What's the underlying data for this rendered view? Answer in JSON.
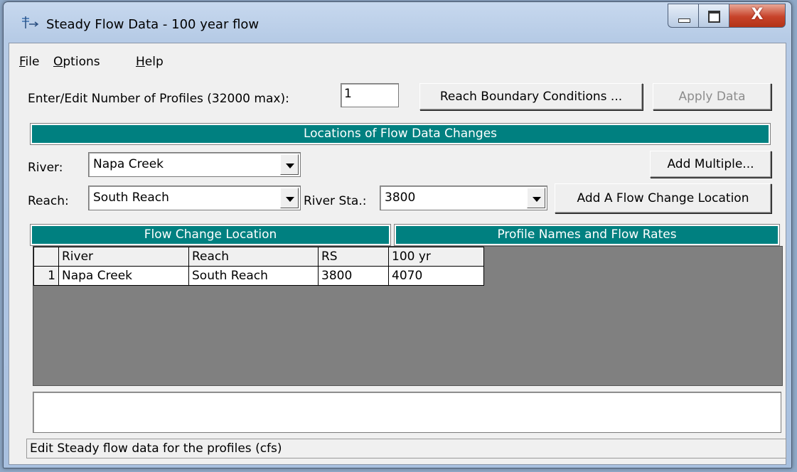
{
  "window": {
    "title": "Steady Flow Data - 100 year flow",
    "icon": "steady-flow-icon",
    "close_glyph": "X"
  },
  "menu": [
    {
      "accel": "F",
      "rest": "ile"
    },
    {
      "accel": "O",
      "rest": "ptions"
    },
    {
      "accel": "H",
      "rest": "elp"
    }
  ],
  "profiles": {
    "label": "Enter/Edit Number of Profiles (32000 max):",
    "value": "1"
  },
  "buttons": {
    "reach_boundary": "Reach Boundary Conditions ...",
    "apply_data": "Apply Data",
    "add_multiple": "Add Multiple...",
    "add_flow_change": "Add A Flow Change Location"
  },
  "locations_header": "Locations of Flow Data Changes",
  "river": {
    "label": "River:",
    "value": "Napa Creek"
  },
  "reach": {
    "label": "Reach:",
    "value": "South Reach"
  },
  "river_sta": {
    "label": "River Sta.:",
    "value": "3800"
  },
  "table": {
    "left_header": "Flow Change Location",
    "right_header": "Profile Names and Flow Rates",
    "columns": [
      "River",
      "Reach",
      "RS",
      "100 yr"
    ],
    "rows": [
      {
        "num": "1",
        "river": "Napa Creek",
        "reach": "South Reach",
        "rs": "3800",
        "flow": "4070"
      }
    ]
  },
  "status": "Edit Steady flow data for the profiles (cfs)",
  "colors": {
    "header_teal": "#008080",
    "grid_gray": "#808080"
  }
}
